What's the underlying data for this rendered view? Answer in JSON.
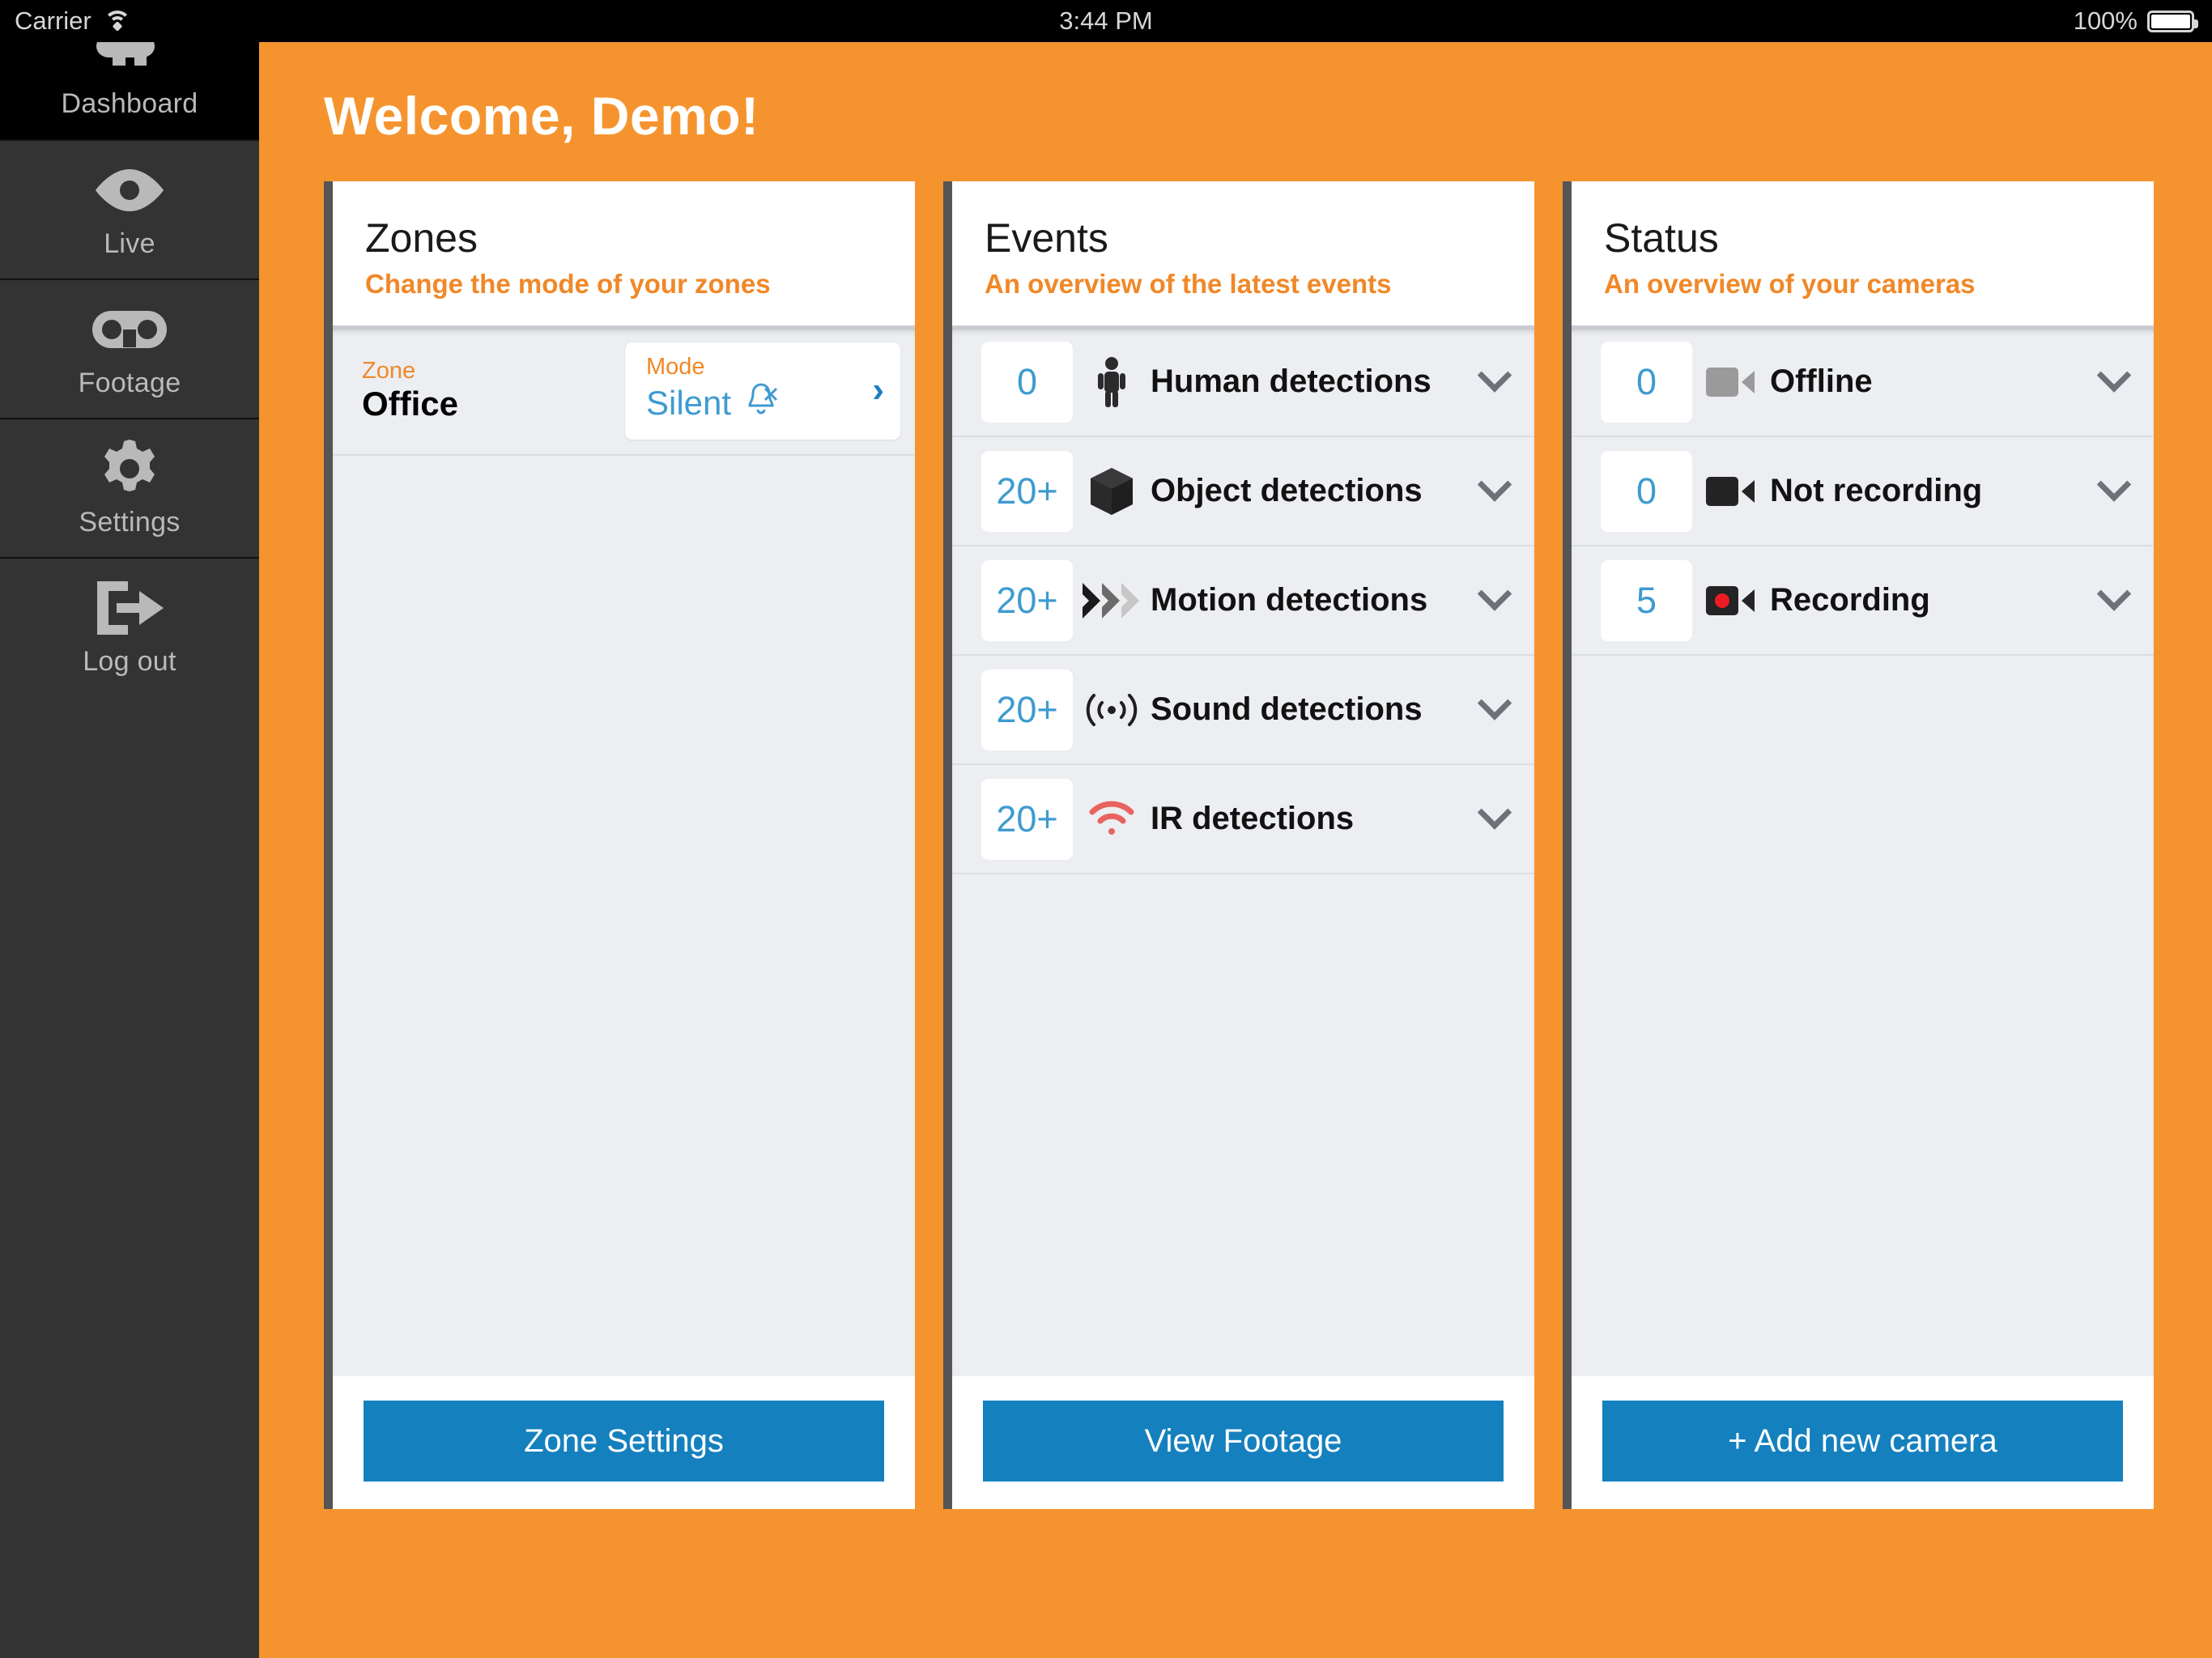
{
  "status_bar": {
    "carrier": "Carrier",
    "wifi_icon": "wifi-icon",
    "time": "3:44 PM",
    "battery_percent": "100%",
    "battery_icon": "battery-full-icon"
  },
  "sidebar": {
    "items": [
      {
        "label": "Dashboard",
        "icon": "home-cloud-icon",
        "active": true
      },
      {
        "label": "Live",
        "icon": "eye-icon",
        "active": false
      },
      {
        "label": "Footage",
        "icon": "film-reel-icon",
        "active": false
      },
      {
        "label": "Settings",
        "icon": "gear-icon",
        "active": false
      },
      {
        "label": "Log out",
        "icon": "logout-arrow-icon",
        "active": false
      }
    ]
  },
  "header": {
    "greeting": "Welcome, Demo!"
  },
  "colors": {
    "accent_orange": "#F5942F",
    "subtitle_orange": "#F08828",
    "blue": "#3E9BD0",
    "button_blue": "#1580BE",
    "sidebar_bg": "#333333",
    "sidebar_active": "#000000",
    "card_body": "#eceef2",
    "card_border": "#555555",
    "recording_red": "#ED1C24",
    "ir_red": "#E8635F"
  },
  "cards": {
    "zones": {
      "title": "Zones",
      "subtitle": "Change the mode of your zones",
      "rows": [
        {
          "zone_label": "Zone",
          "zone_value": "Office",
          "mode_label": "Mode",
          "mode_value": "Silent",
          "mode_icon": "bell-slash-icon",
          "chevron_icon": "chevron-right-icon"
        }
      ],
      "cta": "Zone Settings"
    },
    "events": {
      "title": "Events",
      "subtitle": "An overview of the latest events",
      "rows": [
        {
          "count": "0",
          "label": "Human detections",
          "icon": "person-icon",
          "chevron_icon": "chevron-down-icon"
        },
        {
          "count": "20+",
          "label": "Object detections",
          "icon": "cube-icon",
          "chevron_icon": "chevron-down-icon"
        },
        {
          "count": "20+",
          "label": "Motion detections",
          "icon": "motion-chevrons-icon",
          "chevron_icon": "chevron-down-icon"
        },
        {
          "count": "20+",
          "label": "Sound detections",
          "icon": "sound-wave-icon",
          "chevron_icon": "chevron-down-icon"
        },
        {
          "count": "20+",
          "label": "IR detections",
          "icon": "ir-signal-icon",
          "chevron_icon": "chevron-down-icon"
        }
      ],
      "cta": "View Footage"
    },
    "status": {
      "title": "Status",
      "subtitle": "An overview of your cameras",
      "rows": [
        {
          "count": "0",
          "label": "Offline",
          "icon": "camera-gray-icon",
          "chevron_icon": "chevron-down-icon"
        },
        {
          "count": "0",
          "label": "Not recording",
          "icon": "camera-black-icon",
          "chevron_icon": "chevron-down-icon"
        },
        {
          "count": "5",
          "label": "Recording",
          "icon": "camera-recording-icon",
          "chevron_icon": "chevron-down-icon"
        }
      ],
      "cta": "+ Add new camera"
    }
  }
}
